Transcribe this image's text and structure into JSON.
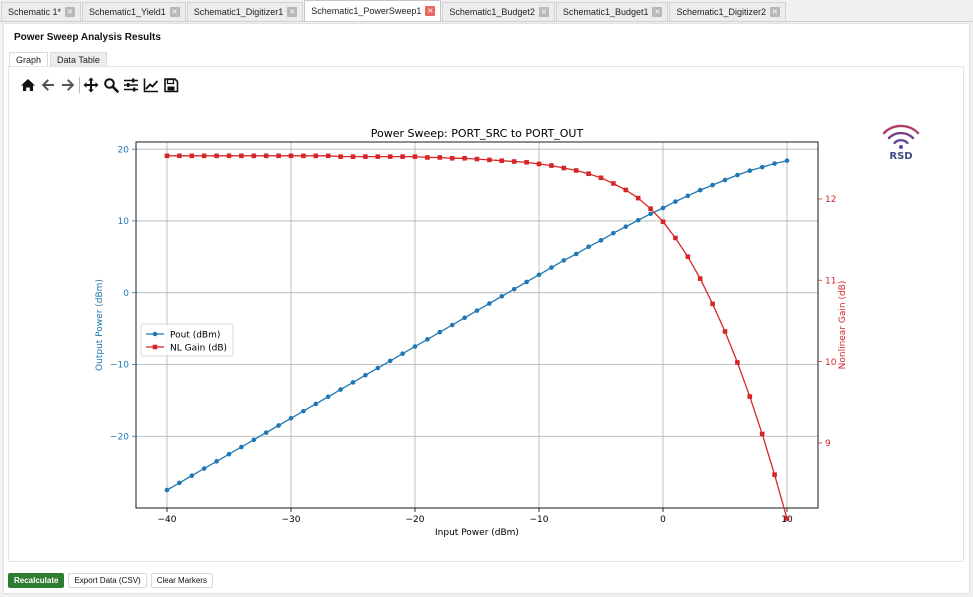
{
  "tabs": [
    {
      "label": "Schematic 1*",
      "active": false
    },
    {
      "label": "Schematic1_Yield1",
      "active": false
    },
    {
      "label": "Schematic1_Digitizer1",
      "active": false
    },
    {
      "label": "Schematic1_PowerSweep1",
      "active": true
    },
    {
      "label": "Schematic1_Budget2",
      "active": false
    },
    {
      "label": "Schematic1_Budget1",
      "active": false
    },
    {
      "label": "Schematic1_Digitizer2",
      "active": false
    }
  ],
  "page": {
    "title": "Power Sweep Analysis Results"
  },
  "subtabs": [
    {
      "label": "Graph",
      "active": true
    },
    {
      "label": "Data Table",
      "active": false
    }
  ],
  "toolbar": {
    "icons": [
      "home-icon",
      "back-arrow-icon",
      "forward-arrow-icon",
      "pan-icon",
      "zoom-icon",
      "configure-subplots-icon",
      "edit-axis-icon",
      "save-icon"
    ]
  },
  "logo": {
    "text": "RSD",
    "color": "#3a4e82",
    "arc_colors": [
      "#b23a6b",
      "#7b3c8a",
      "#5b4a9a"
    ]
  },
  "buttons": {
    "recalculate": "Recalculate",
    "export": "Export Data (CSV)",
    "clear_markers": "Clear Markers"
  },
  "chart_data": {
    "type": "line",
    "title": "Power Sweep: PORT_SRC to PORT_OUT",
    "xlabel": "Input Power (dBm)",
    "ylabel": "Output Power (dBm)",
    "y2label": "Nonlinear Gain (dB)",
    "xlim": [
      -42.5,
      12.5
    ],
    "ylim": [
      -30.0,
      21.0
    ],
    "y2lim": [
      8.2,
      12.7
    ],
    "xticks": [
      -40,
      -30,
      -20,
      -10,
      0,
      10
    ],
    "yticks": [
      -20,
      -10,
      0,
      10,
      20
    ],
    "y2ticks": [
      9,
      10,
      11,
      12
    ],
    "grid": true,
    "legend_position": "center-left",
    "x": [
      -40,
      -39,
      -38,
      -37,
      -36,
      -35,
      -34,
      -33,
      -32,
      -31,
      -30,
      -29,
      -28,
      -27,
      -26,
      -25,
      -24,
      -23,
      -22,
      -21,
      -20,
      -19,
      -18,
      -17,
      -16,
      -15,
      -14,
      -13,
      -12,
      -11,
      -10,
      -9,
      -8,
      -7,
      -6,
      -5,
      -4,
      -3,
      -2,
      -1,
      0,
      1,
      2,
      3,
      4,
      5,
      6,
      7,
      8,
      9,
      10
    ],
    "series": [
      {
        "name": "Pout (dBm)",
        "color": "#1f77b4",
        "marker": "circle",
        "axis": "left",
        "values": [
          -27.5,
          -26.5,
          -25.5,
          -24.5,
          -23.5,
          -22.5,
          -21.5,
          -20.5,
          -19.5,
          -18.5,
          -17.5,
          -16.5,
          -15.5,
          -14.5,
          -13.5,
          -12.5,
          -11.5,
          -10.5,
          -9.5,
          -8.5,
          -7.5,
          -6.5,
          -5.5,
          -4.5,
          -3.5,
          -2.5,
          -1.5,
          -0.5,
          0.5,
          1.5,
          2.5,
          3.5,
          4.5,
          5.4,
          6.4,
          7.3,
          8.3,
          9.2,
          10.1,
          11.0,
          11.8,
          12.7,
          13.5,
          14.3,
          15.0,
          15.7,
          16.4,
          17.0,
          17.5,
          18.0,
          18.4
        ]
      },
      {
        "name": "NL Gain (dB)",
        "color": "#d62728",
        "marker": "square",
        "axis": "right",
        "values": [
          12.53,
          12.53,
          12.53,
          12.53,
          12.53,
          12.53,
          12.53,
          12.53,
          12.53,
          12.53,
          12.53,
          12.53,
          12.53,
          12.53,
          12.52,
          12.52,
          12.52,
          12.52,
          12.52,
          12.52,
          12.52,
          12.51,
          12.51,
          12.5,
          12.5,
          12.49,
          12.48,
          12.47,
          12.46,
          12.45,
          12.43,
          12.41,
          12.38,
          12.35,
          12.31,
          12.26,
          12.19,
          12.11,
          12.01,
          11.88,
          11.72,
          11.52,
          11.29,
          11.02,
          10.71,
          10.37,
          9.99,
          9.57,
          9.11,
          8.61,
          8.07
        ]
      }
    ]
  }
}
